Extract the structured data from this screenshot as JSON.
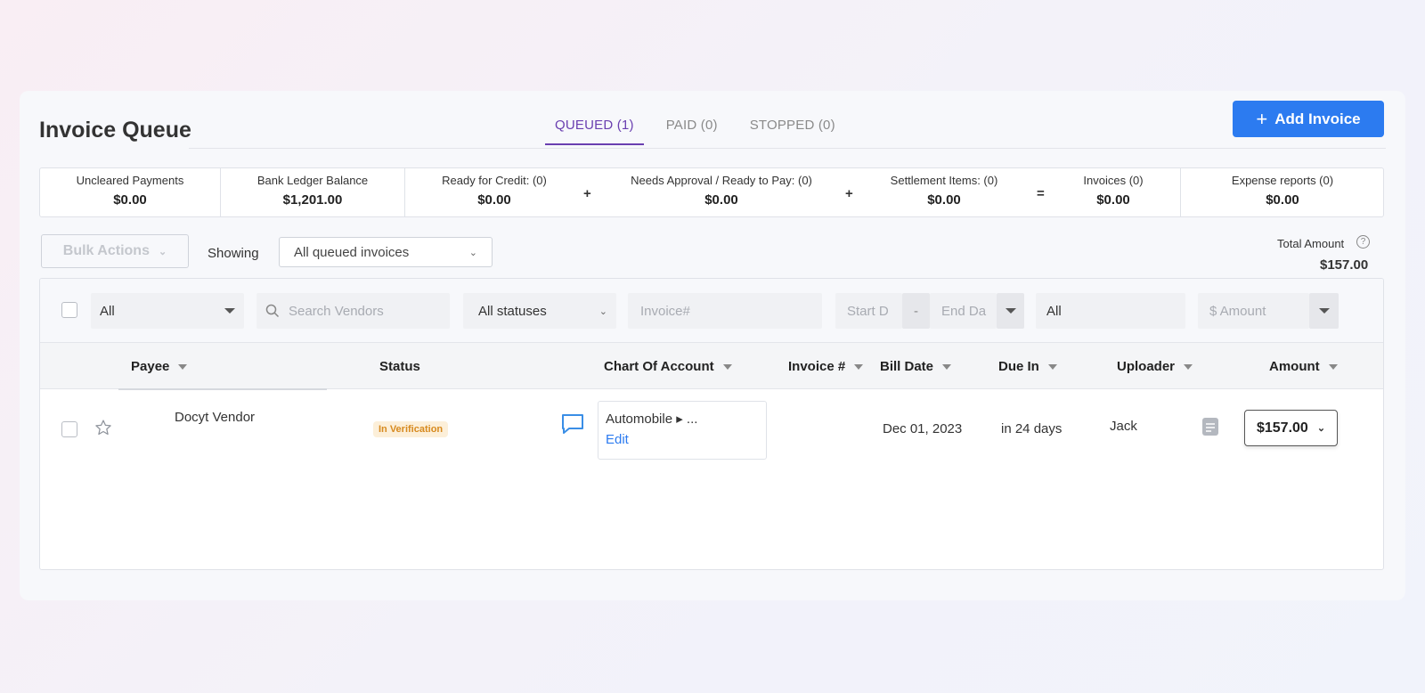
{
  "header": {
    "title": "Invoice Queue",
    "tabs": [
      {
        "label": "QUEUED (1)"
      },
      {
        "label": "PAID (0)"
      },
      {
        "label": "STOPPED (0)"
      }
    ],
    "add_invoice_label": "Add Invoice"
  },
  "summary": [
    {
      "label": "Uncleared Payments",
      "value": "$0.00"
    },
    {
      "label": "Bank Ledger Balance",
      "value": "$1,201.00"
    },
    {
      "label": "Ready for Credit: (0)",
      "value": "$0.00"
    },
    {
      "label": "Needs Approval / Ready to Pay: (0)",
      "value": "$0.00"
    },
    {
      "label": "Settlement Items: (0)",
      "value": "$0.00"
    },
    {
      "label": "Invoices (0)",
      "value": "$0.00"
    },
    {
      "label": "Expense reports (0)",
      "value": "$0.00"
    }
  ],
  "summary_ops": [
    "+",
    "+",
    "="
  ],
  "toolbar": {
    "bulk_actions_label": "Bulk Actions",
    "showing_label": "Showing",
    "showing_value": "All queued invoices",
    "total_amount_label": "Total Amount",
    "total_amount_value": "$157.00"
  },
  "filters": {
    "type_value": "All",
    "search_placeholder": "Search Vendors",
    "status_value": "All statuses",
    "invoice_placeholder": "Invoice#",
    "start_date_placeholder": "Start D",
    "date_separator": "-",
    "end_date_placeholder": "End Da",
    "uploader_value": "All",
    "amount_placeholder": "$ Amount"
  },
  "columns": [
    "Payee",
    "Status",
    "Chart Of Account",
    "Invoice #",
    "Bill Date",
    "Due In",
    "Uploader",
    "Amount"
  ],
  "rows": [
    {
      "payee": "Docyt Vendor",
      "status": "In Verification",
      "chart_of_account": "Automobile ▸ ...",
      "edit_label": "Edit",
      "invoice_no": "",
      "bill_date": "Dec 01, 2023",
      "due_in": "in 24 days",
      "uploader": "Jack",
      "amount": "$157.00"
    }
  ],
  "colors": {
    "accent_blue": "#2c7bf0",
    "tab_active": "#6a3fb0",
    "badge_bg": "#fcefd9",
    "badge_text": "#d78a1f"
  }
}
